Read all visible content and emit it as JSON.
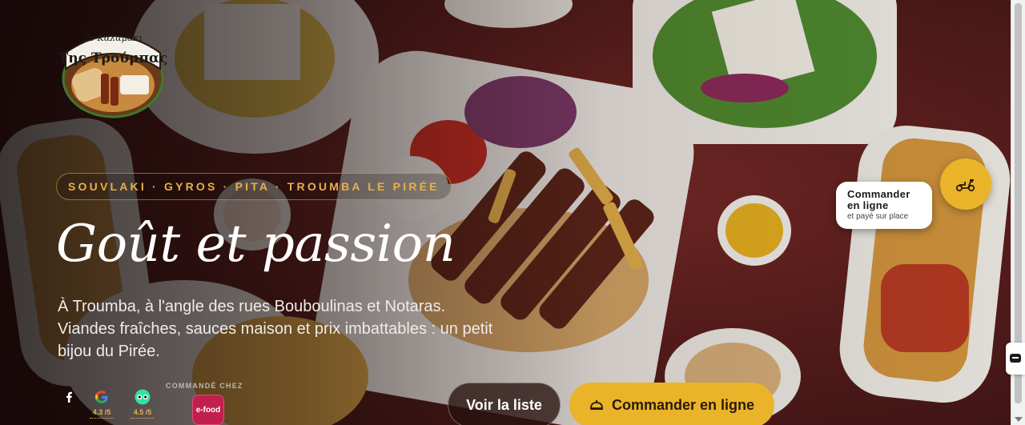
{
  "brand": {
    "logo_top_text": "Το Καλαμάκι",
    "logo_main_text": "Της Τρούμπας"
  },
  "hero": {
    "tagline": "SOUVLAKI · GYROS · PITA · TROUMBA LE PIRÉE",
    "title": "Goût et passion",
    "description": "À Troumba, à l'angle des rues Bouboulinas et Notaras. Viandes fraîches, sauces maison et prix imbattables : un petit bijou du Pirée."
  },
  "social": [
    {
      "icon": "facebook-icon",
      "glyph": "f",
      "rating": ""
    },
    {
      "icon": "google-icon",
      "glyph": "G",
      "rating": "4.3 /5"
    },
    {
      "icon": "tripadvisor-icon",
      "glyph": "oo",
      "rating": "4.5 /5"
    }
  ],
  "ordered_at": {
    "label": "COMMANDÉ CHEZ",
    "efood_label": "e-food"
  },
  "buttons": {
    "view_list": "Voir la liste",
    "order_online": "Commander en ligne"
  },
  "floating_order": {
    "line1": "Commander",
    "line2": "en ligne",
    "line3": "et payé sur place"
  },
  "colors": {
    "accent": "#eab42a",
    "brand_red": "#5a1e1c",
    "efood": "#c21f4f"
  }
}
